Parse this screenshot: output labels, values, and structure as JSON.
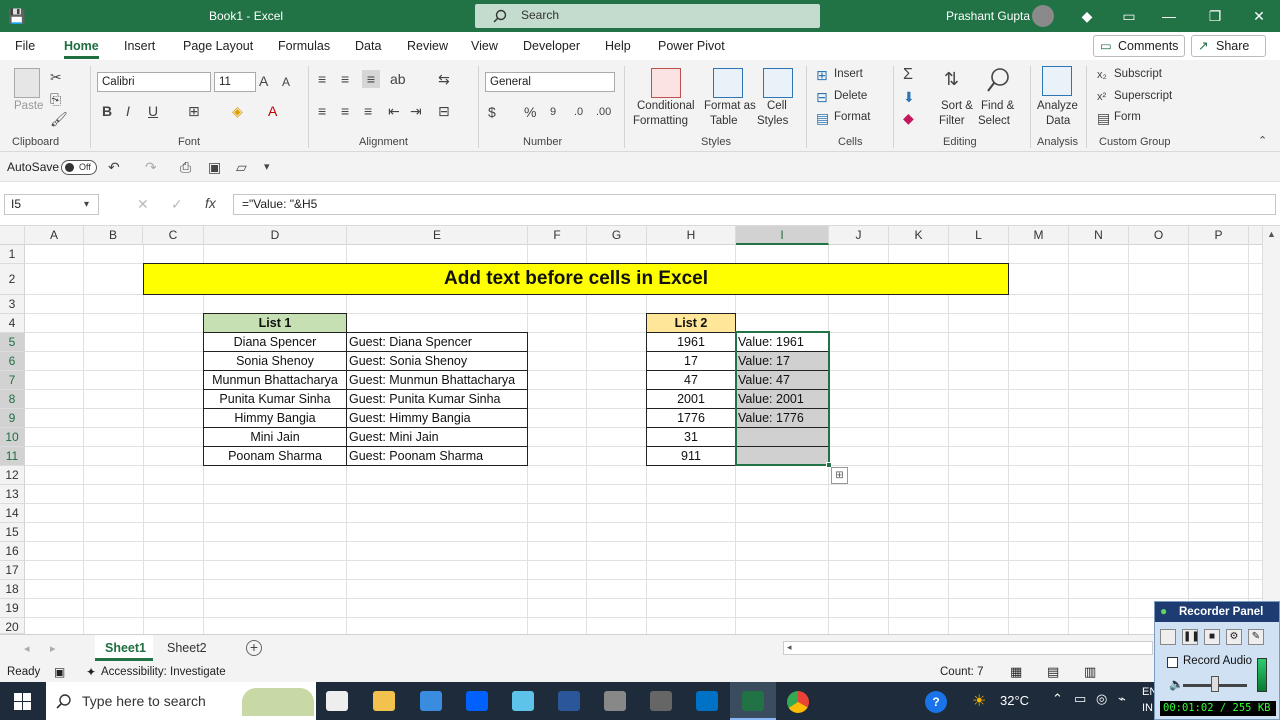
{
  "titlebar": {
    "title": "Book1  -  Excel",
    "search_placeholder": "Search",
    "user": "Prashant Gupta"
  },
  "tabs": [
    "File",
    "Home",
    "Insert",
    "Page Layout",
    "Formulas",
    "Data",
    "Review",
    "View",
    "Developer",
    "Help",
    "Power Pivot"
  ],
  "comments_label": "Comments",
  "share_label": "Share",
  "ribbon": {
    "clipboard": {
      "paste": "Paste",
      "label": "Clipboard"
    },
    "font": {
      "name": "Calibri",
      "size": "11",
      "label": "Font"
    },
    "alignment": {
      "label": "Alignment"
    },
    "number": {
      "format": "General",
      "label": "Number"
    },
    "styles": {
      "conditional": "Conditional",
      "conditional2": "Formatting",
      "format_as": "Format as",
      "format_as2": "Table",
      "cell": "Cell",
      "cell2": "Styles",
      "label": "Styles"
    },
    "cells": {
      "insert": "Insert",
      "delete": "Delete",
      "format": "Format",
      "label": "Cells"
    },
    "editing": {
      "sort": "Sort &",
      "sort2": "Filter",
      "find": "Find &",
      "find2": "Select",
      "label": "Editing"
    },
    "analysis": {
      "analyze": "Analyze",
      "analyze2": "Data",
      "label": "Analysis"
    },
    "custom": {
      "subscript": "Subscript",
      "superscript": "Superscript",
      "form": "Form",
      "label": "Custom Group"
    }
  },
  "qat": {
    "autosave": "AutoSave",
    "toggle": "Off"
  },
  "formula_bar": {
    "name_box": "I5",
    "formula": "=\"Value: \"&H5"
  },
  "columns": [
    "A",
    "B",
    "C",
    "D",
    "E",
    "F",
    "G",
    "H",
    "I",
    "J",
    "K",
    "L",
    "M",
    "N",
    "O",
    "P"
  ],
  "rows": [
    "1",
    "2",
    "3",
    "4",
    "5",
    "6",
    "7",
    "8",
    "9",
    "10",
    "11",
    "12",
    "13",
    "14",
    "15",
    "16",
    "17",
    "18",
    "19",
    "20"
  ],
  "sheet": {
    "banner": "Add text before cells in Excel",
    "list1_header": "List 1",
    "list1": [
      "Diana Spencer",
      "Sonia Shenoy",
      "Munmun Bhattacharya",
      "Punita Kumar Sinha",
      "Himmy Bangia",
      "Mini Jain",
      "Poonam Sharma"
    ],
    "guests": [
      "Guest: Diana Spencer",
      "Guest: Sonia Shenoy",
      "Guest: Munmun Bhattacharya",
      "Guest: Punita Kumar Sinha",
      "Guest: Himmy Bangia",
      "Guest: Mini Jain",
      "Guest: Poonam Sharma"
    ],
    "list2_header": "List 2",
    "list2": [
      "1961",
      "17",
      "47",
      "2001",
      "1776",
      "31",
      "911"
    ],
    "values": [
      "Value: 1961",
      "Value: 17",
      "Value: 47",
      "Value: 2001",
      "Value: 1776",
      "",
      ""
    ]
  },
  "sheet_tabs": [
    "Sheet1",
    "Sheet2"
  ],
  "status": {
    "ready": "Ready",
    "accessibility": "Accessibility: Investigate",
    "count": "Count: 7"
  },
  "taskbar": {
    "search": "Type here to search",
    "weather": "32°C",
    "lang": "EN",
    "lang2": "IN"
  },
  "recorder": {
    "title": "Recorder Panel",
    "audio": "Record Audio",
    "time": "00:01:02 / 255 KB"
  },
  "colors": {
    "excel_green": "#217346",
    "banner_yellow": "#ffff00",
    "list1_header": "#c6e0b4",
    "list2_header": "#ffe699",
    "selection_gray": "#d0d0d0"
  }
}
